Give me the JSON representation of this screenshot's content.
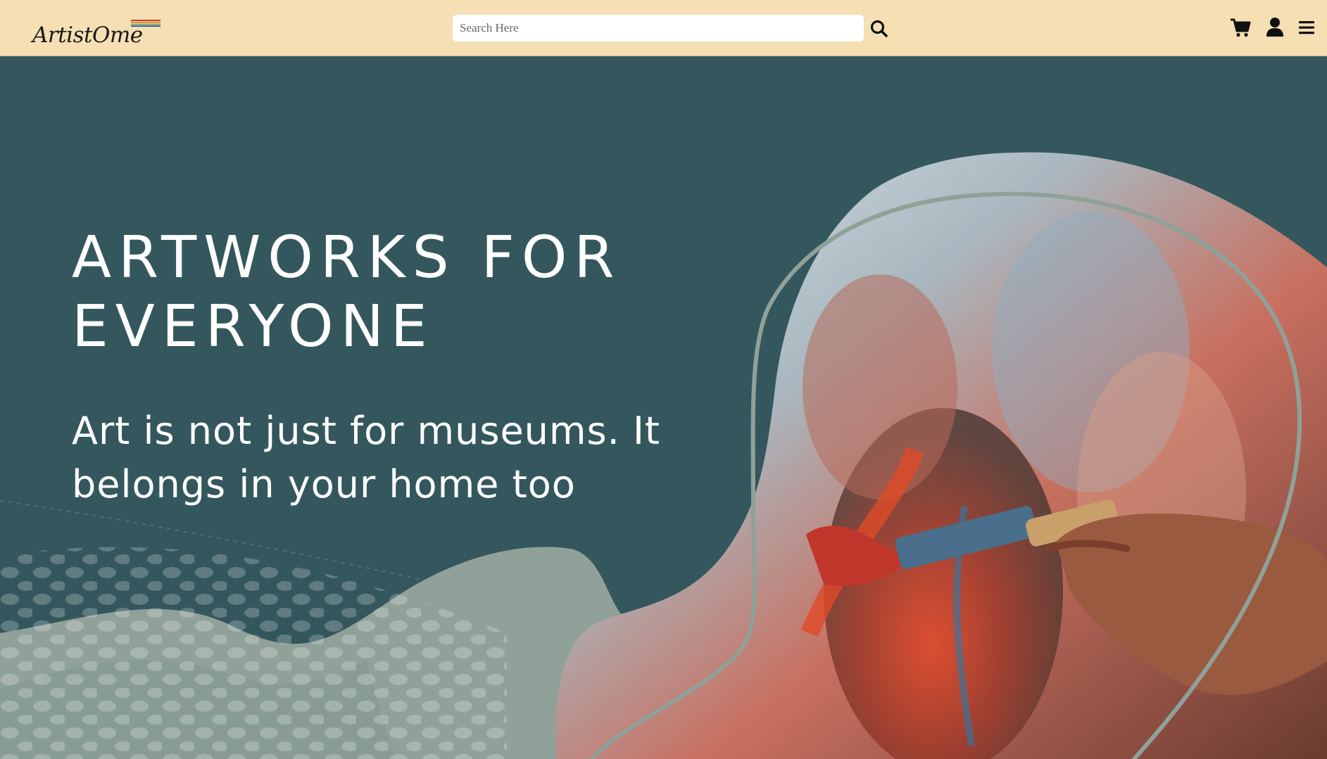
{
  "header": {
    "logo_text": "ArtistOme",
    "logo_stripe_colors": [
      "#c0392b",
      "#d98e2c",
      "#3b8a4a",
      "#2c5aa0"
    ],
    "search": {
      "placeholder": "Search Here",
      "value": ""
    },
    "icons": [
      "search-icon",
      "cart-icon",
      "user-icon",
      "menu-icon"
    ]
  },
  "hero": {
    "headline_line1": "ARTWORKS FOR",
    "headline_line2": "EVERYONE",
    "subheadline": "Art is not just for museums. It belongs in your home too"
  },
  "colors": {
    "navbar_bg": "#f5dfb3",
    "hero_bg": "#34575e",
    "sage": "#8fa198",
    "text_light": "#ffffff"
  }
}
